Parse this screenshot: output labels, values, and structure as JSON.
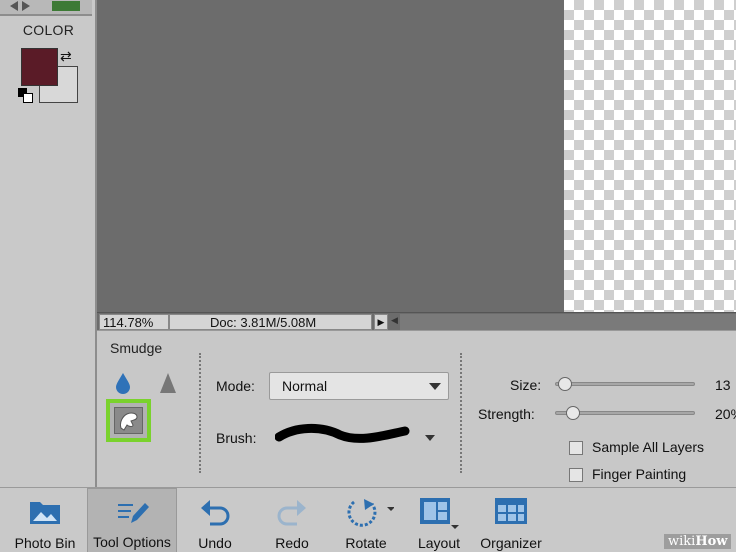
{
  "toolbox": {
    "color_label": "COLOR",
    "foreground_color": "#5a1b27",
    "background_color": "#d8d8d8"
  },
  "status": {
    "zoom": "114.78%",
    "doc": "Doc: 3.81M/5.08M"
  },
  "tool_options": {
    "tool_name": "Smudge",
    "mode_label": "Mode:",
    "mode_value": "Normal",
    "brush_label": "Brush:",
    "size_label": "Size:",
    "size_value": "13",
    "size_fraction": 0.02,
    "strength_label": "Strength:",
    "strength_value": "20%",
    "strength_fraction": 0.08,
    "sample_all_layers_label": "Sample All Layers",
    "sample_all_layers_checked": false,
    "finger_painting_label": "Finger Painting",
    "finger_painting_checked": false,
    "highlight_color": "#7ad22d"
  },
  "taskbar": {
    "photo_bin": "Photo Bin",
    "tool_options": "Tool Options",
    "undo": "Undo",
    "redo": "Redo",
    "rotate": "Rotate",
    "layout": "Layout",
    "organizer": "Organizer"
  },
  "watermark": {
    "wiki": "wiki",
    "how": "How"
  }
}
